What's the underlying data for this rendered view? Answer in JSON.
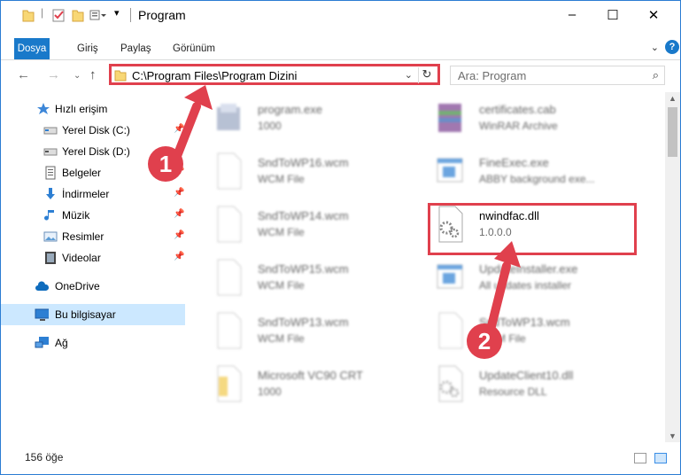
{
  "window": {
    "title": "Program",
    "controls": {
      "minimize": "–",
      "maximize": "☐",
      "close": "✕"
    }
  },
  "ribbon": {
    "tabs": [
      "Dosya",
      "Giriş",
      "Paylaş",
      "Görünüm"
    ],
    "active_tab": "Dosya",
    "help": "?"
  },
  "nav": {
    "address": "C:\\Program Files\\Program Dizini",
    "search_placeholder": "Ara: Program"
  },
  "sidebar": {
    "items": [
      {
        "label": "Hızlı erişim",
        "icon": "star-icon"
      },
      {
        "label": "Yerel Disk (C:)",
        "icon": "drive-icon",
        "pinned": true
      },
      {
        "label": "Yerel Disk (D:)",
        "icon": "drive-icon",
        "pinned": true
      },
      {
        "label": "Belgeler",
        "icon": "documents-icon",
        "pinned": true
      },
      {
        "label": "İndirmeler",
        "icon": "download-icon",
        "pinned": true
      },
      {
        "label": "Müzik",
        "icon": "music-icon",
        "pinned": true
      },
      {
        "label": "Resimler",
        "icon": "pictures-icon",
        "pinned": true
      },
      {
        "label": "Videolar",
        "icon": "video-icon",
        "pinned": true
      },
      {
        "label": "OneDrive",
        "icon": "cloud-icon"
      },
      {
        "label": "Bu bilgisayar",
        "icon": "computer-icon",
        "selected": true
      },
      {
        "label": "Ağ",
        "icon": "network-icon"
      }
    ]
  },
  "files": [
    {
      "name": "program.exe",
      "desc": "1000",
      "icon": "installer-icon"
    },
    {
      "name": "certificates.cab",
      "desc": "WinRAR Archive",
      "icon": "archive-icon"
    },
    {
      "name": "SndToWP16.wcm",
      "desc": "WCM File",
      "icon": "blank-file-icon"
    },
    {
      "name": "FineExec.exe",
      "desc": "ABBY background exe...",
      "icon": "window-file-icon"
    },
    {
      "name": "SndToWP14.wcm",
      "desc": "WCM File",
      "icon": "blank-file-icon"
    },
    {
      "name": "nwindfac.dll",
      "desc": "1.0.0.0",
      "icon": "dll-icon",
      "highlighted": true
    },
    {
      "name": "SndToWP15.wcm",
      "desc": "WCM File",
      "icon": "blank-file-icon"
    },
    {
      "name": "UpdateInstaller.exe",
      "desc": "All updates installer",
      "icon": "window-file-icon"
    },
    {
      "name": "SndToWP13.wcm",
      "desc": "WCM File",
      "icon": "blank-file-icon"
    },
    {
      "name": "SndToWP13.wcm",
      "desc": "WCM File",
      "icon": "blank-file-icon"
    },
    {
      "name": "Microsoft VC90 CRT",
      "desc": "1000",
      "icon": "folder-doc-icon"
    },
    {
      "name": "UpdateClient10.dll",
      "desc": "Resource DLL",
      "icon": "dll-icon"
    }
  ],
  "status": {
    "count": "156 öğe"
  },
  "annotations": {
    "step1": "1",
    "step2": "2"
  },
  "colors": {
    "accent": "#1979ca",
    "annotation": "#e0404d",
    "selected": "#cce8ff"
  }
}
